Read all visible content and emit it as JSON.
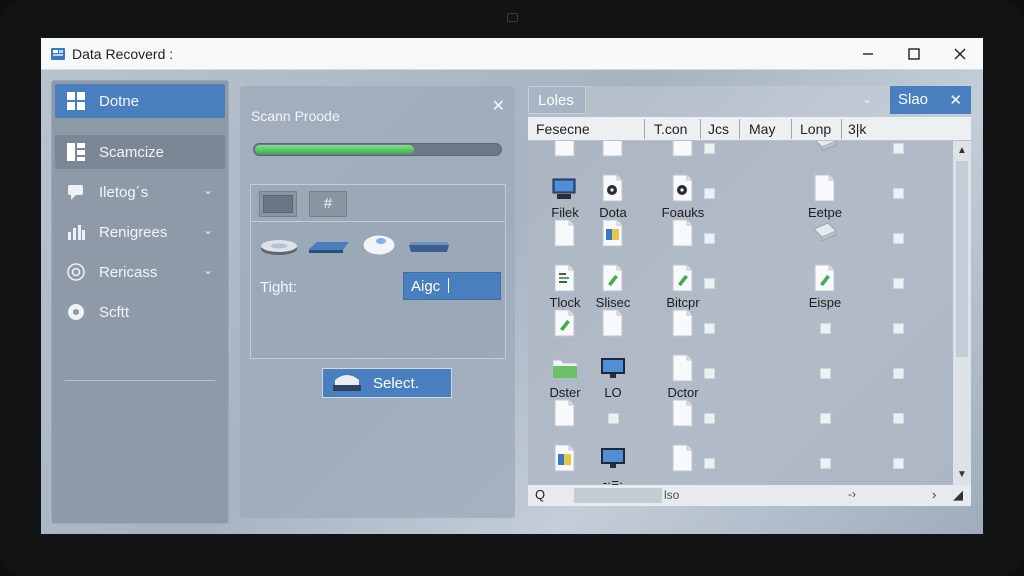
{
  "window": {
    "title": "Data Recoverd :",
    "controls": [
      "minimize-icon",
      "maximize-icon",
      "close-icon"
    ]
  },
  "sidebar": {
    "items": [
      {
        "label": "Dotne",
        "icon": "dashboard-grid-icon",
        "state": "active",
        "chevron": false
      },
      {
        "label": "Scamcize",
        "icon": "list-grid-icon",
        "state": "selected",
        "chevron": false
      },
      {
        "label": "Iletog´s",
        "icon": "chat-bubble-icon",
        "state": "normal",
        "chevron": true
      },
      {
        "label": "Renigrees",
        "icon": "bar-chart-icon",
        "state": "normal",
        "chevron": true
      },
      {
        "label": "Rericass",
        "icon": "target-icon",
        "state": "normal",
        "chevron": true
      },
      {
        "label": "Scftt",
        "icon": "help-icon",
        "state": "normal",
        "chevron": false
      }
    ]
  },
  "scan": {
    "title": "Scann Proode",
    "progress": 0.65,
    "tabs": [
      "",
      "#"
    ],
    "drives": [
      "hdd-icon",
      "ssd-icon",
      "mouse-icon",
      "disk-icon"
    ],
    "tight_label": "Tight:",
    "align_value": "Aigc",
    "select_label": "Select."
  },
  "files": {
    "search_tab": "Loles",
    "filter_label": "Slao",
    "columns": [
      "Fesecne",
      "T.con",
      "Jcs",
      "May",
      "Lonp",
      "3|k"
    ],
    "rows": [
      [
        {
          "icon": "doc-icon",
          "name": ""
        },
        {
          "icon": "doc-icon",
          "name": ""
        },
        {
          "icon": "doc-icon",
          "name": ""
        },
        {
          "icon": "tools-icon",
          "name": ""
        }
      ],
      [
        {
          "icon": "computer-icon",
          "name": "Filek"
        },
        {
          "icon": "media-icon",
          "name": "Dota"
        },
        {
          "icon": "media-icon",
          "name": "Foauks"
        },
        {
          "icon": "doc-icon",
          "name": "Eetpe"
        }
      ],
      [
        {
          "icon": "doc-icon",
          "name": ""
        },
        {
          "icon": "image-icon",
          "name": ""
        },
        {
          "icon": "doc-icon",
          "name": ""
        },
        {
          "icon": "tools-icon",
          "name": ""
        }
      ],
      [
        {
          "icon": "text-icon",
          "name": "Tlock"
        },
        {
          "icon": "green-doc-icon",
          "name": "Slisec"
        },
        {
          "icon": "green-doc-icon",
          "name": "Bitcpr"
        },
        {
          "icon": "green-doc-icon",
          "name": "Eispe"
        }
      ],
      [
        {
          "icon": "green-doc-icon",
          "name": ""
        },
        {
          "icon": "doc-icon",
          "name": ""
        },
        {
          "icon": "doc-icon",
          "name": ""
        },
        {
          "icon": "blank-icon",
          "name": ""
        }
      ],
      [
        {
          "icon": "folder-icon",
          "name": "Dster"
        },
        {
          "icon": "monitor-icon",
          "name": "LO"
        },
        {
          "icon": "doc-icon",
          "name": "Dctor"
        },
        {
          "icon": "blank-icon",
          "name": ""
        }
      ],
      [
        {
          "icon": "doc-icon",
          "name": ""
        },
        {
          "icon": "blank-icon",
          "name": ""
        },
        {
          "icon": "doc-icon",
          "name": ""
        },
        {
          "icon": "blank-icon",
          "name": ""
        }
      ],
      [
        {
          "icon": "image-icon",
          "name": ""
        },
        {
          "icon": "monitor-icon",
          "name": "-·=·"
        },
        {
          "icon": "doc-icon",
          "name": ""
        },
        {
          "icon": "blank-icon",
          "name": ""
        }
      ]
    ],
    "status": {
      "q": "Q",
      "label": "lso",
      "dash": "-›",
      "nav": "›"
    }
  },
  "colors": {
    "accent": "#4a7fbf",
    "progress": "#3fae4f",
    "panel": "#8e9aa8"
  }
}
